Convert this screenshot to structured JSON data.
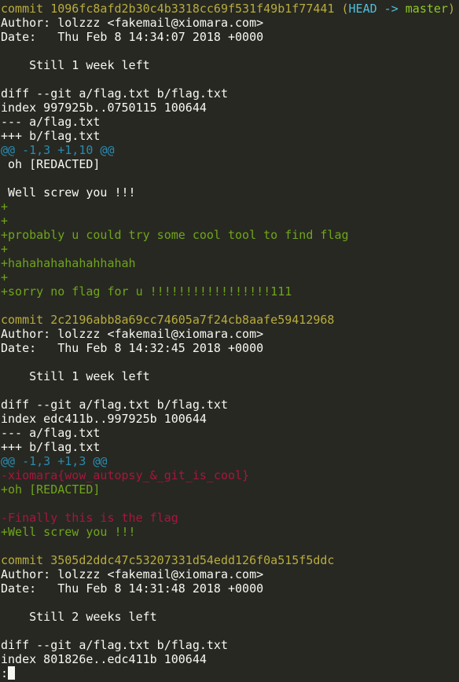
{
  "colors": {
    "background": "#272822",
    "text": "#f8f8f2",
    "commit": "#b8ac3c",
    "head_ref": "#4ec0dc",
    "branch_ref": "#8ec920",
    "hunk_header": "#2a8bb0",
    "added": "#6fa51a",
    "removed": "#a8163d"
  },
  "commits": [
    {
      "commit_line": "commit 1096fc8afd2b30c4b3318cc69f531f49b1f77441 ",
      "ref_open": "(",
      "ref_head": "HEAD -> ",
      "ref_branch": "master",
      "ref_close": ")",
      "author": "Author: lolzzz <fakemail@xiomara.com>",
      "date": "Date:   Thu Feb 8 14:34:07 2018 +0000",
      "message": "    Still 1 week left",
      "diff_header": "diff --git a/flag.txt b/flag.txt",
      "index": "index 997925b..0750115 100644",
      "old_file": "--- a/flag.txt",
      "new_file": "+++ b/flag.txt",
      "hunk": "@@ -1,3 +1,10 @@",
      "lines": [
        {
          "type": "plain",
          "text": " oh [REDACTED]"
        },
        {
          "type": "plain",
          "text": ""
        },
        {
          "type": "plain",
          "text": " Well screw you !!!"
        },
        {
          "type": "add",
          "text": "+"
        },
        {
          "type": "add",
          "text": "+"
        },
        {
          "type": "add",
          "text": "+probably u could try some cool tool to find flag"
        },
        {
          "type": "add",
          "text": "+"
        },
        {
          "type": "add",
          "text": "+hahahahahahahhahah"
        },
        {
          "type": "add",
          "text": "+"
        },
        {
          "type": "add",
          "text": "+sorry no flag for u !!!!!!!!!!!!!!!!!111"
        }
      ]
    },
    {
      "commit_line": "commit 2c2196abb8a69cc74605a7f24cb8aafe59412968",
      "author": "Author: lolzzz <fakemail@xiomara.com>",
      "date": "Date:   Thu Feb 8 14:32:45 2018 +0000",
      "message": "    Still 1 week left",
      "diff_header": "diff --git a/flag.txt b/flag.txt",
      "index": "index edc411b..997925b 100644",
      "old_file": "--- a/flag.txt",
      "new_file": "+++ b/flag.txt",
      "hunk": "@@ -1,3 +1,3 @@",
      "lines": [
        {
          "type": "del",
          "text": "-xiomara{wow_autopsy_&_git_is_cool}"
        },
        {
          "type": "add",
          "text": "+oh [REDACTED]"
        },
        {
          "type": "plain",
          "text": ""
        },
        {
          "type": "del",
          "text": "-Finally this is the flag"
        },
        {
          "type": "add",
          "text": "+Well screw you !!!"
        }
      ]
    },
    {
      "commit_line": "commit 3505d2ddc47c53207331d54edd126f0a515f5ddc",
      "author": "Author: lolzzz <fakemail@xiomara.com>",
      "date": "Date:   Thu Feb 8 14:31:48 2018 +0000",
      "message": "    Still 2 weeks left",
      "diff_header": "diff --git a/flag.txt b/flag.txt",
      "index": "index 801826e..edc411b 100644"
    }
  ],
  "pager_prompt": ":"
}
